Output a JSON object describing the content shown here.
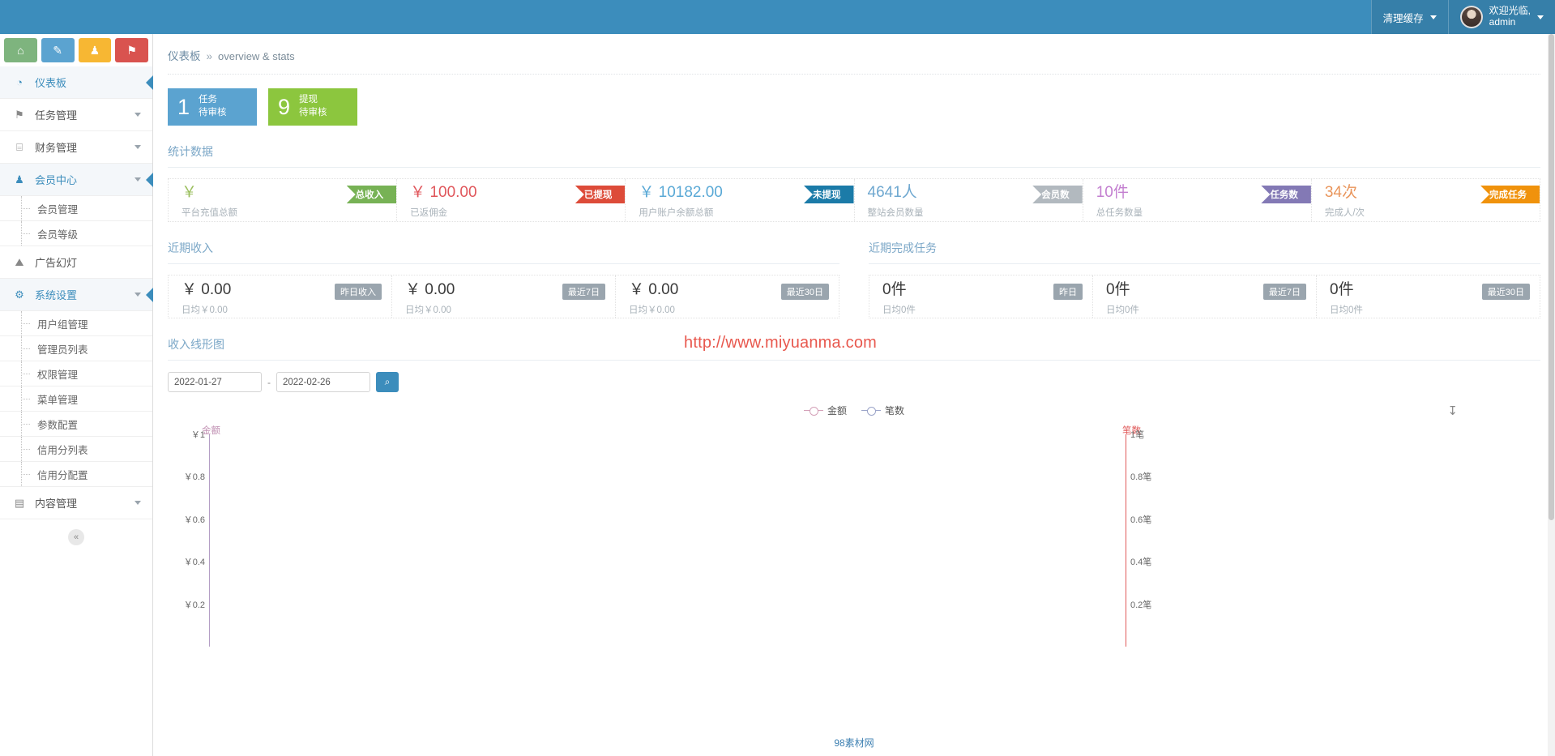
{
  "topbar": {
    "logo": "",
    "cache_label": "清理缓存",
    "welcome_line1": "欢迎光临,",
    "welcome_line2": "admin",
    "brand_color": "#3c8dbc"
  },
  "sidebar": {
    "quick_buttons": [
      {
        "name": "home",
        "glyph": "⌂",
        "color": "#7eb47e"
      },
      {
        "name": "edit",
        "glyph": "✎",
        "color": "#5ba3d0"
      },
      {
        "name": "users",
        "glyph": "♟",
        "color": "#f7b733"
      },
      {
        "name": "bell",
        "glyph": "⚑",
        "color": "#d9534f"
      }
    ],
    "items": [
      {
        "label": "仪表板",
        "icon": "dashboard-icon",
        "glyph": "◔",
        "active": true,
        "caret": false
      },
      {
        "label": "任务管理",
        "icon": "flag-icon",
        "glyph": "⚑",
        "active": false,
        "caret": true
      },
      {
        "label": "财务管理",
        "icon": "box-icon",
        "glyph": "⌸",
        "active": false,
        "caret": true
      },
      {
        "label": "会员中心",
        "icon": "user-icon",
        "glyph": "♟",
        "active": true,
        "caret": true
      },
      {
        "label": "广告幻灯",
        "icon": "image-icon",
        "glyph": "⛰",
        "active": false,
        "caret": false
      },
      {
        "label": "系统设置",
        "icon": "gear-icon",
        "glyph": "⚙",
        "active": true,
        "caret": true
      },
      {
        "label": "内容管理",
        "icon": "book-icon",
        "glyph": "▤",
        "active": false,
        "caret": true
      }
    ],
    "member_sub": [
      "会员管理",
      "会员等级"
    ],
    "system_sub": [
      "用户组管理",
      "管理员列表",
      "权限管理",
      "菜单管理",
      "参数配置",
      "信用分列表",
      "信用分配置"
    ],
    "collapse_glyph": "«"
  },
  "breadcrumb": {
    "current": "仪表板",
    "separator": "»",
    "sub": "overview & stats"
  },
  "pending": [
    {
      "count": "1",
      "line1": "任务",
      "line2": "待审核",
      "color": "#5ba3d0"
    },
    {
      "count": "9",
      "line1": "提现",
      "line2": "待审核",
      "color": "#8cc63e"
    }
  ],
  "stats_section": {
    "title": "统计数据",
    "cells": [
      {
        "value": "￥",
        "value_color": "#9bbf5e",
        "sub": "平台充值总额",
        "ribbon": "总收入",
        "ribbon_color": "#77b255"
      },
      {
        "value": "￥ 100.00",
        "value_color": "#e0565b",
        "sub": "已返佣金",
        "ribbon": "已提现",
        "ribbon_color": "#dd4b39"
      },
      {
        "value": "￥ 10182.00",
        "value_color": "#5aa9d6",
        "sub": "用户账户余额总额",
        "ribbon": "未提现",
        "ribbon_color": "#1b7ba8"
      },
      {
        "value": "4641人",
        "value_color": "#6fa8d0",
        "sub": "整站会员数量",
        "ribbon": "会员数",
        "ribbon_color": "#b2b9bf"
      },
      {
        "value": "10件",
        "value_color": "#c37fd0",
        "sub": "总任务数量",
        "ribbon": "任务数",
        "ribbon_color": "#8379b5"
      },
      {
        "value": "34次",
        "value_color": "#e9955b",
        "sub": "完成人/次",
        "ribbon": "完成任务",
        "ribbon_color": "#f0920c"
      }
    ]
  },
  "recent_income": {
    "title": "近期收入",
    "cells": [
      {
        "value": "￥ 0.00",
        "sub": "日均￥0.00",
        "tag": "昨日收入"
      },
      {
        "value": "￥ 0.00",
        "sub": "日均￥0.00",
        "tag": "最近7日"
      },
      {
        "value": "￥ 0.00",
        "sub": "日均￥0.00",
        "tag": "最近30日"
      }
    ]
  },
  "recent_tasks": {
    "title": "近期完成任务",
    "cells": [
      {
        "value": "0件",
        "sub": "日均0件",
        "tag": "昨日"
      },
      {
        "value": "0件",
        "sub": "日均0件",
        "tag": "最近7日"
      },
      {
        "value": "0件",
        "sub": "日均0件",
        "tag": "最近30日"
      }
    ]
  },
  "watermark": "http://www.miyuanma.com",
  "footer_credit": "98素材网",
  "chart_section": {
    "title": "收入线形图",
    "date_from": "2022-01-27",
    "date_to": "2022-02-26",
    "date_sep": "-",
    "search_glyph": "⌕",
    "download_glyph": "↧"
  },
  "chart_data": {
    "type": "line",
    "title": "收入线形图",
    "xlabel": "",
    "ylabel": "金额",
    "y2label": "笔数",
    "x": [],
    "series": [
      {
        "name": "金额",
        "color": "#d4a0b8",
        "values": [],
        "axis": "left"
      },
      {
        "name": "笔数",
        "color": "#9aa3c8",
        "values": [],
        "axis": "right"
      }
    ],
    "legend": [
      "金额",
      "笔数"
    ],
    "legend_position": "top-center",
    "grid": false,
    "ylim": [
      0,
      1
    ],
    "y2lim": [
      0,
      1
    ],
    "yticks": [
      "￥1",
      "￥0.8",
      "￥0.6",
      "￥0.4",
      "￥0.2"
    ],
    "y2ticks": [
      "1笔",
      "0.8笔",
      "0.6笔",
      "0.4笔",
      "0.2笔"
    ],
    "ytick_values": [
      1,
      0.8,
      0.6,
      0.4,
      0.2
    ],
    "y2tick_values": [
      1,
      0.8,
      0.6,
      0.4,
      0.2
    ],
    "left_axis_color": "#c08fb2",
    "right_axis_color": "#e05a5a"
  }
}
